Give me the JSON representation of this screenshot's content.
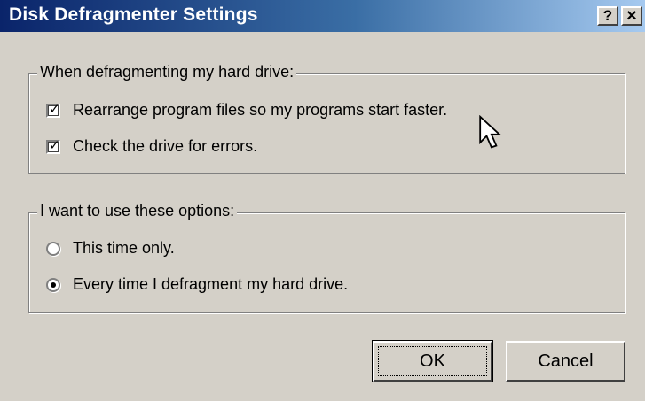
{
  "window": {
    "title": "Disk Defragmenter Settings",
    "help_glyph": "?",
    "close_glyph": "×"
  },
  "group_drive": {
    "legend": "When defragmenting my hard drive:",
    "options": [
      {
        "label": "Rearrange program files so my programs start faster.",
        "checked": true
      },
      {
        "label": "Check the drive for errors.",
        "checked": true
      }
    ]
  },
  "group_options": {
    "legend": "I want to use these options:",
    "options": [
      {
        "label": "This time only.",
        "selected": false
      },
      {
        "label": "Every time I defragment my hard drive.",
        "selected": true
      }
    ]
  },
  "buttons": {
    "ok": "OK",
    "cancel": "Cancel"
  },
  "colors": {
    "titlebar_start": "#0a246a",
    "titlebar_end": "#a6caf0",
    "face": "#d4d0c8"
  }
}
